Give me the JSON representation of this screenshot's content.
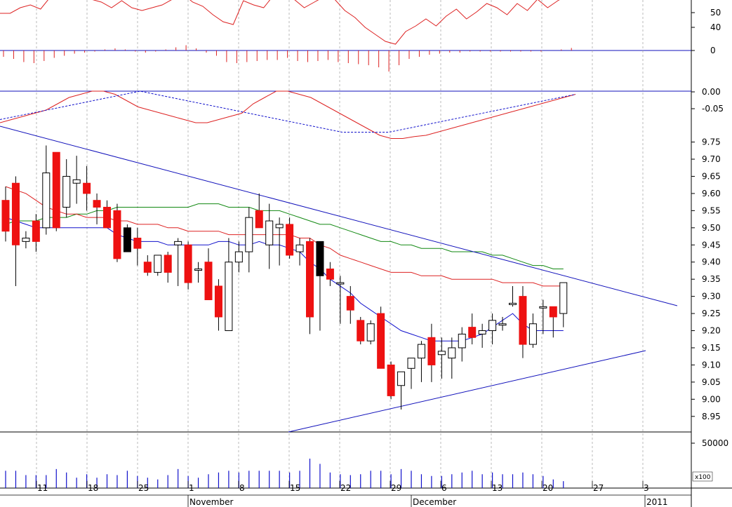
{
  "colors": {
    "up_candle": "#ffffff",
    "down_candle": "#ee1111",
    "black_candle": "#000000",
    "ma_short": "#1010cc",
    "ma_mid": "#dd2222",
    "ma_long": "#118811",
    "trend_line": "#1111bb",
    "volume": "#1111cc",
    "grid": "#aaaaaa",
    "indicator_red": "#dd2222",
    "macd_signal": "#1111cc"
  },
  "chart_data": [
    {
      "type": "line",
      "panel": "oscillator",
      "ylim": [
        20,
        70
      ],
      "ticks": [
        "50",
        "40"
      ],
      "x": [
        "Oct 6",
        "Oct 7",
        "Oct 8",
        "Oct 11",
        "Oct 12",
        "Oct 13",
        "Oct 14",
        "Oct 15",
        "Oct 18",
        "Oct 19",
        "Oct 20",
        "Oct 21",
        "Oct 22",
        "Oct 25",
        "Oct 26",
        "Oct 27",
        "Oct 28",
        "Oct 29",
        "Nov 1",
        "Nov 2",
        "Nov 3",
        "Nov 4",
        "Nov 5",
        "Nov 8",
        "Nov 9",
        "Nov 10",
        "Nov 11",
        "Nov 12",
        "Nov 15",
        "Nov 16",
        "Nov 17",
        "Nov 18",
        "Nov 19",
        "Nov 22",
        "Nov 23",
        "Nov 24",
        "Nov 25",
        "Nov 26",
        "Nov 29",
        "Nov 30",
        "Dec 1",
        "Dec 2",
        "Dec 3",
        "Dec 6",
        "Dec 7",
        "Dec 8",
        "Dec 9",
        "Dec 10",
        "Dec 13",
        "Dec 14",
        "Dec 15",
        "Dec 16",
        "Dec 17",
        "Dec 20",
        "Dec 21",
        "Dec 22",
        "Dec 23"
      ],
      "series": [
        {
          "values": [
            48,
            48,
            52,
            54,
            51,
            60,
            69,
            58,
            60,
            58,
            56,
            52,
            57,
            52,
            50,
            52,
            54,
            58,
            62,
            56,
            53,
            47,
            42,
            40,
            57,
            54,
            52,
            61,
            64,
            58,
            52,
            56,
            60,
            58,
            50,
            45,
            38,
            33,
            28,
            26,
            35,
            39,
            44,
            39,
            46,
            51,
            44,
            49,
            55,
            52,
            47,
            55,
            50,
            58,
            52,
            57,
            61
          ]
        }
      ]
    },
    {
      "type": "bar",
      "panel": "histogram",
      "ylim": [
        -1,
        1
      ],
      "ticks": [
        "0"
      ],
      "series": [
        {
          "values": [
            -0.3,
            -0.4,
            -0.55,
            -0.6,
            -0.5,
            -0.35,
            -0.25,
            -0.15,
            -0.1,
            -0.05,
            0.05,
            0.1,
            0.05,
            -0.05,
            -0.1,
            -0.05,
            0.05,
            0.15,
            0.25,
            0.1,
            -0.1,
            -0.25,
            -0.55,
            -0.6,
            -0.55,
            -0.5,
            -0.45,
            -0.45,
            -0.35,
            -0.5,
            -0.55,
            -0.5,
            -0.45,
            -0.55,
            -0.6,
            -0.65,
            -0.7,
            -0.8,
            -1.0,
            -0.7,
            -0.4,
            -0.3,
            -0.2,
            -0.15,
            -0.1,
            -0.1,
            -0.05,
            -0.05,
            -0.05,
            -0.05,
            -0.05,
            -0.05,
            -0.05,
            -0.05,
            0.0,
            0.05,
            0.12
          ]
        }
      ]
    },
    {
      "type": "line",
      "panel": "macd",
      "ylim": [
        -0.085,
        0.01
      ],
      "ticks": [
        "0.00",
        "-0.05"
      ],
      "series": [
        {
          "role": "macd",
          "values": [
            -0.05,
            -0.045,
            -0.04,
            -0.035,
            -0.03,
            -0.02,
            -0.01,
            -0.005,
            0.0,
            0.0,
            -0.005,
            -0.015,
            -0.025,
            -0.03,
            -0.035,
            -0.04,
            -0.045,
            -0.05,
            -0.05,
            -0.045,
            -0.04,
            -0.035,
            -0.02,
            -0.01,
            0.0,
            0.0,
            -0.005,
            -0.01,
            -0.02,
            -0.03,
            -0.04,
            -0.05,
            -0.06,
            -0.07,
            -0.075,
            -0.075,
            -0.072,
            -0.07,
            -0.065,
            -0.06,
            -0.055,
            -0.05,
            -0.045,
            -0.04,
            -0.035,
            -0.03,
            -0.025,
            -0.02,
            -0.015,
            -0.01,
            -0.005
          ]
        },
        {
          "role": "signal",
          "values": [
            -0.045,
            -0.04,
            -0.035,
            -0.03,
            -0.025,
            -0.02,
            -0.015,
            -0.01,
            -0.005,
            0.0,
            -0.005,
            -0.01,
            -0.015,
            -0.02,
            -0.025,
            -0.03,
            -0.035,
            -0.04,
            -0.045,
            -0.05,
            -0.055,
            -0.06,
            -0.065,
            -0.065,
            -0.065,
            -0.065,
            -0.06,
            -0.055,
            -0.05,
            -0.045,
            -0.04,
            -0.035,
            -0.03,
            -0.025,
            -0.02,
            -0.015,
            -0.01,
            -0.005
          ]
        }
      ]
    },
    {
      "type": "candlestick",
      "panel": "price",
      "ylim": [
        8.9,
        9.8
      ],
      "ticks": [
        "9.75",
        "9.70",
        "9.65",
        "9.60",
        "9.55",
        "9.50",
        "9.45",
        "9.40",
        "9.35",
        "9.30",
        "9.25",
        "9.20",
        "9.15",
        "9.10",
        "9.05",
        "9.00",
        "8.95"
      ],
      "x": [
        "Oct 7",
        "Oct 8",
        "Oct 11",
        "Oct 12",
        "Oct 13",
        "Oct 14",
        "Oct 15",
        "Oct 18",
        "Oct 19",
        "Oct 20",
        "Oct 21",
        "Oct 22",
        "Oct 25",
        "Oct 26",
        "Oct 27",
        "Oct 28",
        "Oct 29",
        "Nov 1",
        "Nov 2",
        "Nov 3",
        "Nov 4",
        "Nov 5",
        "Nov 8",
        "Nov 9",
        "Nov 10",
        "Nov 11",
        "Nov 12",
        "Nov 15",
        "Nov 16",
        "Nov 17",
        "Nov 18",
        "Nov 19",
        "Nov 22",
        "Nov 23",
        "Nov 24",
        "Nov 25",
        "Nov 26",
        "Nov 29",
        "Nov 30",
        "Dec 1",
        "Dec 2",
        "Dec 3",
        "Dec 6",
        "Dec 7",
        "Dec 8",
        "Dec 9",
        "Dec 10",
        "Dec 13",
        "Dec 14",
        "Dec 15",
        "Dec 16",
        "Dec 17",
        "Dec 20",
        "Dec 21",
        "Dec 22",
        "Dec 23"
      ],
      "ohlc": [
        [
          9.58,
          9.62,
          9.46,
          9.49
        ],
        [
          9.63,
          9.65,
          9.33,
          9.45
        ],
        [
          9.46,
          9.49,
          9.44,
          9.47
        ],
        [
          9.52,
          9.54,
          9.43,
          9.46
        ],
        [
          9.5,
          9.74,
          9.48,
          9.66
        ],
        [
          9.72,
          9.72,
          9.49,
          9.5
        ],
        [
          9.56,
          9.7,
          9.53,
          9.65
        ],
        [
          9.63,
          9.71,
          9.57,
          9.64
        ],
        [
          9.63,
          9.68,
          9.55,
          9.6
        ],
        [
          9.58,
          9.6,
          9.51,
          9.56
        ],
        [
          9.56,
          9.58,
          9.5,
          9.5
        ],
        [
          9.55,
          9.57,
          9.4,
          9.41
        ],
        [
          9.5,
          9.51,
          9.43,
          9.43
        ],
        [
          9.47,
          9.5,
          9.39,
          9.44
        ],
        [
          9.4,
          9.42,
          9.36,
          9.37
        ],
        [
          9.37,
          9.42,
          9.36,
          9.42
        ],
        [
          9.42,
          9.43,
          9.34,
          9.37
        ],
        [
          9.45,
          9.47,
          9.33,
          9.46
        ],
        [
          9.45,
          9.46,
          9.32,
          9.34
        ],
        [
          9.38,
          9.4,
          9.34,
          9.38
        ],
        [
          9.4,
          9.44,
          9.29,
          9.29
        ],
        [
          9.33,
          9.35,
          9.2,
          9.24
        ],
        [
          9.2,
          9.47,
          9.2,
          9.4
        ],
        [
          9.4,
          9.46,
          9.37,
          9.43
        ],
        [
          9.43,
          9.56,
          9.37,
          9.53
        ],
        [
          9.55,
          9.6,
          9.5,
          9.5
        ],
        [
          9.45,
          9.57,
          9.38,
          9.52
        ],
        [
          9.5,
          9.53,
          9.39,
          9.51
        ],
        [
          9.51,
          9.53,
          9.41,
          9.42
        ],
        [
          9.43,
          9.47,
          9.39,
          9.45
        ],
        [
          9.46,
          9.47,
          9.19,
          9.24
        ],
        [
          9.46,
          9.46,
          9.2,
          9.36
        ],
        [
          9.38,
          9.4,
          9.33,
          9.35
        ],
        [
          9.34,
          9.36,
          9.22,
          9.34
        ],
        [
          9.3,
          9.33,
          9.22,
          9.26
        ],
        [
          9.23,
          9.24,
          9.16,
          9.17
        ],
        [
          9.17,
          9.23,
          9.16,
          9.22
        ],
        [
          9.25,
          9.27,
          9.09,
          9.09
        ],
        [
          9.1,
          9.11,
          9.0,
          9.01
        ],
        [
          9.04,
          9.08,
          8.97,
          9.08
        ],
        [
          9.09,
          9.1,
          9.03,
          9.12
        ],
        [
          9.12,
          9.17,
          9.05,
          9.16
        ],
        [
          9.18,
          9.22,
          9.05,
          9.1
        ],
        [
          9.13,
          9.18,
          9.06,
          9.14
        ],
        [
          9.12,
          9.18,
          9.06,
          9.15
        ],
        [
          9.15,
          9.21,
          9.11,
          9.19
        ],
        [
          9.21,
          9.25,
          9.16,
          9.18
        ],
        [
          9.19,
          9.22,
          9.15,
          9.2
        ],
        [
          9.2,
          9.25,
          9.16,
          9.23
        ],
        [
          9.22,
          9.24,
          9.2,
          9.22
        ],
        [
          9.28,
          9.33,
          9.27,
          9.28
        ],
        [
          9.3,
          9.33,
          9.12,
          9.16
        ],
        [
          9.16,
          9.25,
          9.15,
          9.22
        ],
        [
          9.27,
          9.29,
          9.19,
          9.27
        ],
        [
          9.27,
          9.27,
          9.18,
          9.24
        ],
        [
          9.25,
          9.34,
          9.21,
          9.34
        ]
      ],
      "ma_short": [
        9.53,
        9.52,
        9.51,
        9.5,
        9.5,
        9.5,
        9.5,
        9.5,
        9.5,
        9.5,
        9.5,
        9.48,
        9.47,
        9.46,
        9.46,
        9.46,
        9.45,
        9.45,
        9.45,
        9.45,
        9.45,
        9.46,
        9.46,
        9.45,
        9.45,
        9.46,
        9.45,
        9.45,
        9.44,
        9.43,
        9.4,
        9.38,
        9.35,
        9.33,
        9.31,
        9.28,
        9.26,
        9.24,
        9.22,
        9.2,
        9.19,
        9.18,
        9.17,
        9.17,
        9.17,
        9.17,
        9.18,
        9.19,
        9.21,
        9.23,
        9.25,
        9.22,
        9.2,
        9.2,
        9.2,
        9.2
      ],
      "ma_mid": [
        9.62,
        9.61,
        9.6,
        9.58,
        9.56,
        9.55,
        9.54,
        9.54,
        9.53,
        9.53,
        9.53,
        9.52,
        9.52,
        9.51,
        9.51,
        9.51,
        9.5,
        9.5,
        9.49,
        9.49,
        9.49,
        9.49,
        9.48,
        9.48,
        9.48,
        9.48,
        9.48,
        9.48,
        9.48,
        9.47,
        9.47,
        9.45,
        9.44,
        9.42,
        9.41,
        9.4,
        9.39,
        9.38,
        9.37,
        9.37,
        9.37,
        9.36,
        9.36,
        9.36,
        9.35,
        9.35,
        9.35,
        9.35,
        9.35,
        9.34,
        9.34,
        9.34,
        9.34,
        9.33,
        9.33,
        9.33
      ],
      "ma_long": [
        9.51,
        9.52,
        9.52,
        9.52,
        9.53,
        9.53,
        9.53,
        9.54,
        9.54,
        9.55,
        9.55,
        9.56,
        9.56,
        9.56,
        9.56,
        9.56,
        9.56,
        9.56,
        9.56,
        9.57,
        9.57,
        9.57,
        9.56,
        9.56,
        9.56,
        9.55,
        9.55,
        9.55,
        9.54,
        9.53,
        9.52,
        9.51,
        9.51,
        9.5,
        9.49,
        9.48,
        9.47,
        9.46,
        9.46,
        9.45,
        9.45,
        9.44,
        9.44,
        9.44,
        9.43,
        9.43,
        9.43,
        9.43,
        9.42,
        9.42,
        9.41,
        9.4,
        9.39,
        9.39,
        9.38,
        9.38
      ]
    },
    {
      "type": "bar",
      "panel": "volume",
      "ylim": [
        0,
        60000
      ],
      "ticks": [
        "50000"
      ],
      "unit_label": "x100",
      "series": [
        {
          "values": [
            20000,
            20000,
            15000,
            15000,
            15000,
            22000,
            18000,
            12000,
            16000,
            12000,
            16000,
            15000,
            20000,
            14000,
            12000,
            10000,
            15000,
            22000,
            14000,
            12000,
            16000,
            18000,
            20000,
            18000,
            20000,
            20000,
            20000,
            20000,
            18000,
            20000,
            34000,
            28000,
            18000,
            16000,
            15000,
            16000,
            20000,
            20000,
            16000,
            22000,
            20000,
            16000,
            14000,
            14000,
            16000,
            18000,
            20000,
            16000,
            18000,
            16000,
            16000,
            18000,
            16000,
            14000,
            10000,
            8000
          ]
        }
      ]
    }
  ],
  "x_axis": {
    "day_ticks": [
      "11",
      "18",
      "25",
      "1",
      "8",
      "15",
      "22",
      "29",
      "6",
      "13",
      "20",
      "27",
      "3"
    ],
    "month_labels": [
      "November",
      "December",
      "2011"
    ]
  }
}
